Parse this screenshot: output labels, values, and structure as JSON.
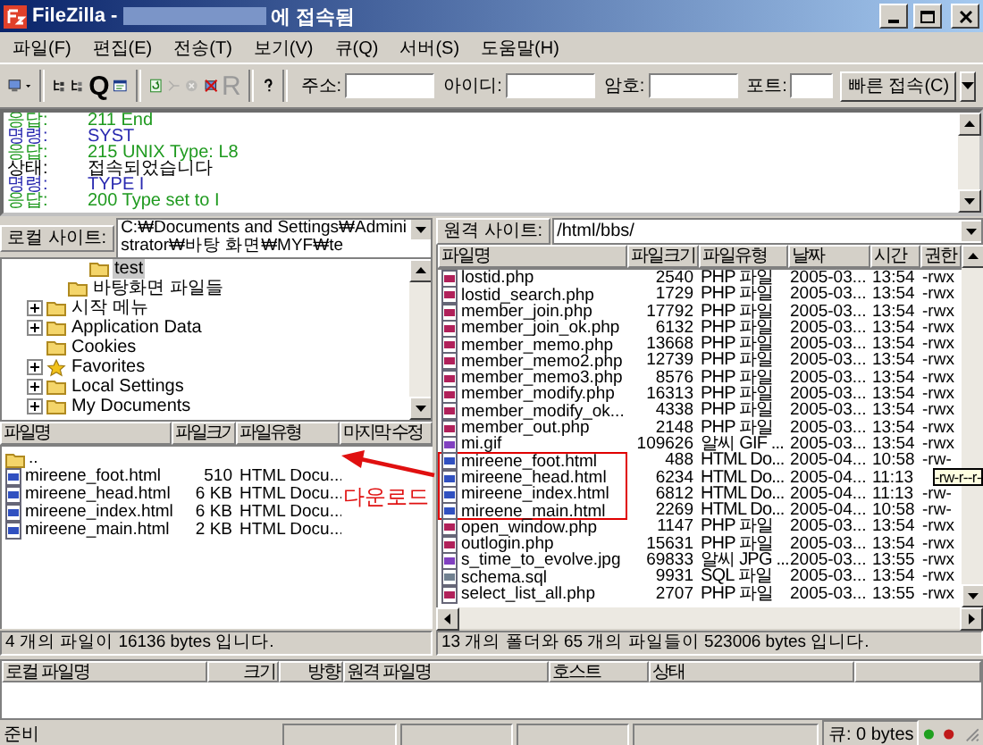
{
  "window": {
    "title": "FileZilla -",
    "title_suffix": "에 접속됨"
  },
  "menu": [
    "파일(F)",
    "편집(E)",
    "전송(T)",
    "보기(V)",
    "큐(Q)",
    "서버(S)",
    "도움말(H)"
  ],
  "toolbar": [
    {
      "kind": "sitemanager",
      "disabled": false
    },
    {
      "kind": "caret",
      "disabled": false
    },
    {
      "kind": "sep"
    },
    {
      "kind": "tree-local",
      "disabled": false
    },
    {
      "kind": "tree-remote",
      "disabled": false
    },
    {
      "kind": "glyph",
      "glyph": "Q",
      "disabled": false
    },
    {
      "kind": "log",
      "disabled": false
    },
    {
      "kind": "sep"
    },
    {
      "kind": "refresh",
      "disabled": false
    },
    {
      "kind": "process",
      "disabled": true
    },
    {
      "kind": "cancel",
      "disabled": true
    },
    {
      "kind": "disconnect",
      "disabled": false
    },
    {
      "kind": "glyph",
      "glyph": "R",
      "disabled": true
    },
    {
      "kind": "sep"
    },
    {
      "kind": "help",
      "disabled": false
    }
  ],
  "quickconnect": {
    "fields": [
      "주소:",
      "아이디:",
      "암호:",
      "포트:"
    ],
    "button": "빠른 접속(C)"
  },
  "log": [
    {
      "kind": "response",
      "label": "응답:",
      "text": "211 End"
    },
    {
      "kind": "command",
      "label": "명령:",
      "text": "SYST"
    },
    {
      "kind": "response",
      "label": "응답:",
      "text": "215 UNIX Type: L8"
    },
    {
      "kind": "status",
      "label": "상태:",
      "text": "접속되었습니다"
    },
    {
      "kind": "command",
      "label": "명령:",
      "text": "TYPE I"
    },
    {
      "kind": "response",
      "label": "응답:",
      "text": "200 Type set to I"
    }
  ],
  "local": {
    "label": "로컬 사이트:",
    "path": "C:₩Documents and Settings₩Administrator₩바탕 화면₩MYF₩te",
    "tree": [
      {
        "children": [
          {
            "children": [
              {
                "label": "test",
                "kind": "folder",
                "selected": true,
                "expandable": false
              }
            ]
          },
          {
            "label": "바탕화면 파일들",
            "kind": "folder",
            "selected": false,
            "expandable": false
          }
        ]
      },
      {
        "label": "시작 메뉴",
        "kind": "folder",
        "selected": false,
        "expandable": true
      },
      {
        "label": "Application Data",
        "kind": "folder",
        "selected": false,
        "expandable": true
      },
      {
        "label": "Cookies",
        "kind": "folder",
        "selected": false,
        "expandable": false
      },
      {
        "label": "Favorites",
        "kind": "favorites",
        "selected": false,
        "expandable": true
      },
      {
        "label": "Local Settings",
        "kind": "folder",
        "selected": false,
        "expandable": true
      },
      {
        "label": "My Documents",
        "kind": "folder",
        "selected": false,
        "expandable": true
      }
    ],
    "columns": [
      "파일명",
      "파일크기",
      "파일유형",
      "마지막 수정"
    ],
    "rows": [
      {
        "kind": "folder",
        "name": ".."
      },
      {
        "kind": "html",
        "name": "mireene_foot.html",
        "size": "510",
        "type": "HTML Docu..."
      },
      {
        "kind": "html",
        "name": "mireene_head.html",
        "size": "6 KB",
        "type": "HTML Docu..."
      },
      {
        "kind": "html",
        "name": "mireene_index.html",
        "size": "6 KB",
        "type": "HTML Docu..."
      },
      {
        "kind": "html",
        "name": "mireene_main.html",
        "size": "2 KB",
        "type": "HTML Docu..."
      }
    ],
    "status": "4 개의 파일이 16136 bytes 입니다."
  },
  "remote": {
    "label": "원격 사이트:",
    "path": "/html/bbs/",
    "columns": [
      "파일명",
      "파일크기",
      "파일유형",
      "날짜",
      "시간",
      "권한"
    ],
    "rows": [
      {
        "kind": "php",
        "name": "lostid.php",
        "size": "2540",
        "type": "PHP 파일",
        "date": "2005-03...",
        "time": "13:54",
        "perm": "-rwx",
        "highlighted": false
      },
      {
        "kind": "php",
        "name": "lostid_search.php",
        "size": "1729",
        "type": "PHP 파일",
        "date": "2005-03...",
        "time": "13:54",
        "perm": "-rwx",
        "highlighted": false
      },
      {
        "kind": "php",
        "name": "member_join.php",
        "size": "17792",
        "type": "PHP 파일",
        "date": "2005-03...",
        "time": "13:54",
        "perm": "-rwx",
        "highlighted": false
      },
      {
        "kind": "php",
        "name": "member_join_ok.php",
        "size": "6132",
        "type": "PHP 파일",
        "date": "2005-03...",
        "time": "13:54",
        "perm": "-rwx",
        "highlighted": false
      },
      {
        "kind": "php",
        "name": "member_memo.php",
        "size": "13668",
        "type": "PHP 파일",
        "date": "2005-03...",
        "time": "13:54",
        "perm": "-rwx",
        "highlighted": false
      },
      {
        "kind": "php",
        "name": "member_memo2.php",
        "size": "12739",
        "type": "PHP 파일",
        "date": "2005-03...",
        "time": "13:54",
        "perm": "-rwx",
        "highlighted": false
      },
      {
        "kind": "php",
        "name": "member_memo3.php",
        "size": "8576",
        "type": "PHP 파일",
        "date": "2005-03...",
        "time": "13:54",
        "perm": "-rwx",
        "highlighted": false
      },
      {
        "kind": "php",
        "name": "member_modify.php",
        "size": "16313",
        "type": "PHP 파일",
        "date": "2005-03...",
        "time": "13:54",
        "perm": "-rwx",
        "highlighted": false
      },
      {
        "kind": "php",
        "name": "member_modify_ok...",
        "size": "4338",
        "type": "PHP 파일",
        "date": "2005-03...",
        "time": "13:54",
        "perm": "-rwx",
        "highlighted": false
      },
      {
        "kind": "php",
        "name": "member_out.php",
        "size": "2148",
        "type": "PHP 파일",
        "date": "2005-03...",
        "time": "13:54",
        "perm": "-rwx",
        "highlighted": false
      },
      {
        "kind": "image",
        "name": "mi.gif",
        "size": "109626",
        "type": "알씨 GIF ...",
        "date": "2005-03...",
        "time": "13:54",
        "perm": "-rwx",
        "highlighted": false
      },
      {
        "kind": "html",
        "name": "mireene_foot.html",
        "size": "488",
        "type": "HTML Do...",
        "date": "2005-04...",
        "time": "10:58",
        "perm": "-rw-",
        "highlighted": true
      },
      {
        "kind": "html",
        "name": "mireene_head.html",
        "size": "6234",
        "type": "HTML Do...",
        "date": "2005-04...",
        "time": "11:13",
        "highlighted": true
      },
      {
        "kind": "html",
        "name": "mireene_index.html",
        "size": "6812",
        "type": "HTML Do...",
        "date": "2005-04...",
        "time": "11:13",
        "perm": "-rw-",
        "highlighted": true
      },
      {
        "kind": "html",
        "name": "mireene_main.html",
        "size": "2269",
        "type": "HTML Do...",
        "date": "2005-04...",
        "time": "10:58",
        "perm": "-rw-",
        "highlighted": true
      },
      {
        "kind": "php",
        "name": "open_window.php",
        "size": "1147",
        "type": "PHP 파일",
        "date": "2005-03...",
        "time": "13:54",
        "perm": "-rwx",
        "highlighted": false
      },
      {
        "kind": "php",
        "name": "outlogin.php",
        "size": "15631",
        "type": "PHP 파일",
        "date": "2005-03...",
        "time": "13:54",
        "perm": "-rwx",
        "highlighted": false
      },
      {
        "kind": "image",
        "name": "s_time_to_evolve.jpg",
        "size": "69833",
        "type": "알씨 JPG ...",
        "date": "2005-03...",
        "time": "13:55",
        "perm": "-rwx",
        "highlighted": false
      },
      {
        "kind": "text",
        "name": "schema.sql",
        "size": "9931",
        "type": "SQL 파일",
        "date": "2005-03...",
        "time": "13:54",
        "perm": "-rwx",
        "highlighted": false
      },
      {
        "kind": "php",
        "name": "select_list_all.php",
        "size": "2707",
        "type": "PHP 파일",
        "date": "2005-03...",
        "time": "13:55",
        "perm": "-rwx",
        "highlighted": false
      }
    ],
    "tooltip": "-rw-r--r-",
    "status": "13 개의 폴더와 65 개의 파일들이 523006 bytes 입니다."
  },
  "annotation": {
    "text": "다운로드"
  },
  "queue": {
    "columns": [
      "로컬 파일명",
      "크기",
      "방향",
      "원격 파일명",
      "호스트",
      "상태"
    ]
  },
  "status_bar": {
    "text": "준비",
    "queue": "큐: 0 bytes"
  }
}
